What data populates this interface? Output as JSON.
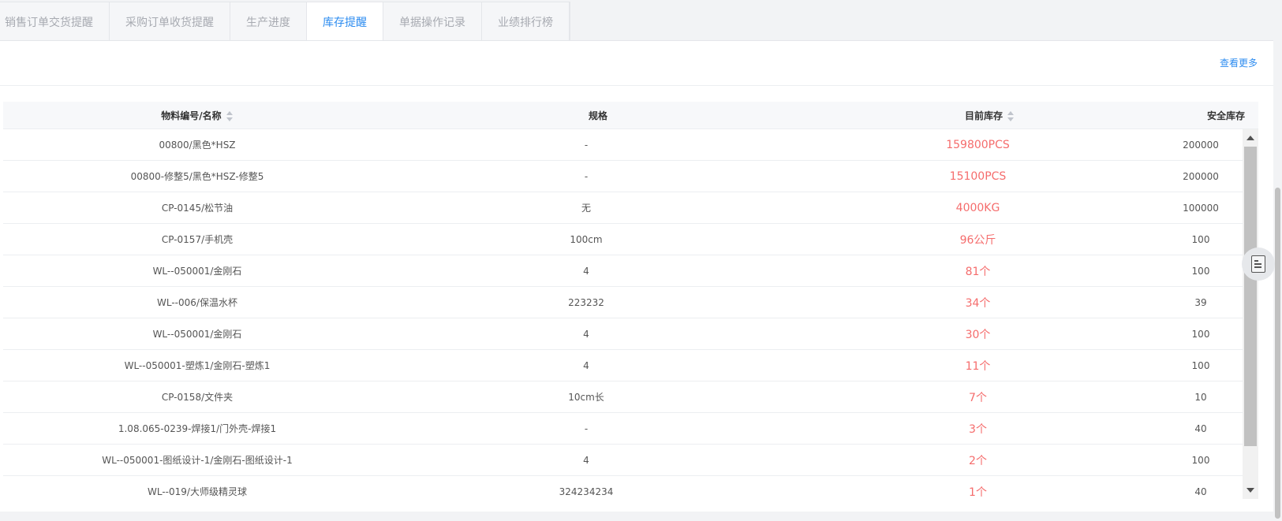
{
  "tabs": [
    {
      "label": "销售订单交货提醒",
      "active": false
    },
    {
      "label": "采购订单收货提醒",
      "active": false
    },
    {
      "label": "生产进度",
      "active": false
    },
    {
      "label": "库存提醒",
      "active": true
    },
    {
      "label": "单据操作记录",
      "active": false
    },
    {
      "label": "业绩排行榜",
      "active": false
    }
  ],
  "panel": {
    "more_label": "查看更多"
  },
  "table": {
    "headers": {
      "material": "物料编号/名称",
      "spec": "规格",
      "current_stock": "目前库存",
      "safety_stock": "安全库存"
    },
    "rows": [
      {
        "material": "00800/黑色*HSZ",
        "spec": "-",
        "current_stock": "159800PCS",
        "safety_stock": "200000"
      },
      {
        "material": "00800-修整5/黑色*HSZ-修整5",
        "spec": "-",
        "current_stock": "15100PCS",
        "safety_stock": "200000"
      },
      {
        "material": "CP-0145/松节油",
        "spec": "无",
        "current_stock": "4000KG",
        "safety_stock": "100000"
      },
      {
        "material": "CP-0157/手机壳",
        "spec": "100cm",
        "current_stock": "96公斤",
        "safety_stock": "100"
      },
      {
        "material": "WL--050001/金刚石",
        "spec": "4",
        "current_stock": "81个",
        "safety_stock": "100"
      },
      {
        "material": "WL--006/保温水杯",
        "spec": "223232",
        "current_stock": "34个",
        "safety_stock": "39"
      },
      {
        "material": "WL--050001/金刚石",
        "spec": "4",
        "current_stock": "30个",
        "safety_stock": "100"
      },
      {
        "material": "WL--050001-塑炼1/金刚石-塑炼1",
        "spec": "4",
        "current_stock": "11个",
        "safety_stock": "100"
      },
      {
        "material": "CP-0158/文件夹",
        "spec": "10cm长",
        "current_stock": "7个",
        "safety_stock": "10"
      },
      {
        "material": "1.08.065-0239-焊接1/门外壳-焊接1",
        "spec": "-",
        "current_stock": "3个",
        "safety_stock": "40"
      },
      {
        "material": "WL--050001-图纸设计-1/金刚石-图纸设计-1",
        "spec": "4",
        "current_stock": "2个",
        "safety_stock": "100"
      },
      {
        "material": "WL--019/大师级精灵球",
        "spec": "324234234",
        "current_stock": "1个",
        "safety_stock": "40"
      }
    ]
  },
  "icons": {
    "float_button": "document-icon",
    "sort": "sort-caret-icon"
  },
  "colors": {
    "accent": "#2d8cf0",
    "stock_warning": "#f56c6c"
  }
}
